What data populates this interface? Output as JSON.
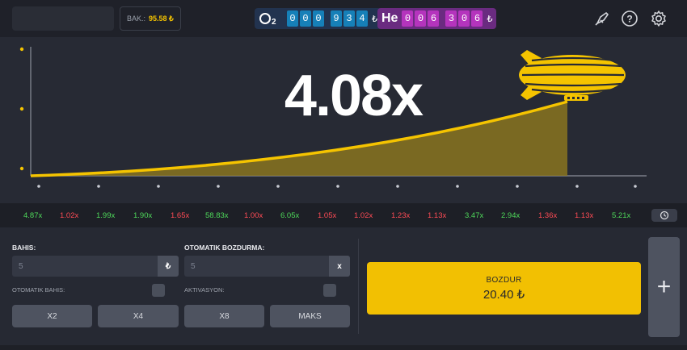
{
  "header": {
    "balance_label": "BAK.:",
    "balance_value": "95.58 ₺",
    "o2": {
      "symbol": "O₂",
      "digits": [
        "0",
        "0",
        "0",
        "9",
        "3",
        "4"
      ],
      "currency": "₺"
    },
    "he": {
      "symbol": "He",
      "digits": [
        "0",
        "0",
        "6",
        "3",
        "0",
        "6"
      ],
      "currency": "₺"
    },
    "icons": [
      "rocket-icon",
      "help-icon",
      "settings-icon"
    ]
  },
  "game": {
    "multiplier": "4.08x",
    "curve_color": "#f5c400",
    "fill_color": "#8a7420"
  },
  "history": [
    {
      "value": "4.87x",
      "status": "green"
    },
    {
      "value": "1.02x",
      "status": "red"
    },
    {
      "value": "1.99x",
      "status": "green"
    },
    {
      "value": "1.90x",
      "status": "green"
    },
    {
      "value": "1.65x",
      "status": "red"
    },
    {
      "value": "58.83x",
      "status": "green"
    },
    {
      "value": "1.00x",
      "status": "red"
    },
    {
      "value": "6.05x",
      "status": "green"
    },
    {
      "value": "1.05x",
      "status": "red"
    },
    {
      "value": "1.02x",
      "status": "red"
    },
    {
      "value": "1.23x",
      "status": "red"
    },
    {
      "value": "1.13x",
      "status": "red"
    },
    {
      "value": "3.47x",
      "status": "green"
    },
    {
      "value": "2.94x",
      "status": "green"
    },
    {
      "value": "1.36x",
      "status": "red"
    },
    {
      "value": "1.13x",
      "status": "red"
    },
    {
      "value": "5.21x",
      "status": "green"
    }
  ],
  "controls": {
    "bet_label": "BAHIS:",
    "bet_value": "5",
    "bet_currency": "₺",
    "auto_cashout_label": "OTOMATIK BOZDURMA:",
    "auto_cashout_value": "5",
    "auto_cashout_clear": "x",
    "auto_bet_label": "OTOMATIK BAHIS:",
    "activation_label": "AKTIVASYON:",
    "quick_buttons": [
      "X2",
      "X4",
      "X8",
      "MAKS"
    ],
    "cashout_title": "BOZDUR",
    "cashout_value": "20.40 ₺",
    "add_label": "+"
  }
}
